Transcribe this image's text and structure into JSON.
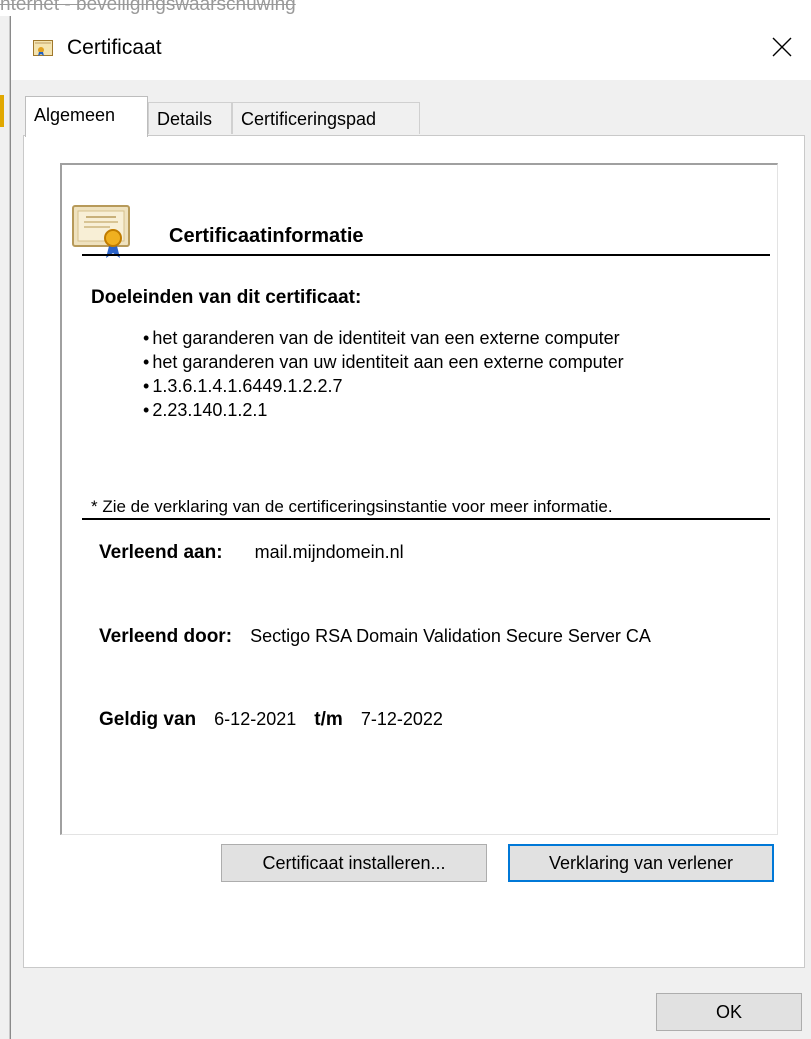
{
  "background_window": {
    "title": "nternet - beveiligingswaarschuwing"
  },
  "dialog": {
    "title": "Certificaat",
    "tabs": [
      {
        "label": "Algemeen",
        "active": true
      },
      {
        "label": "Details",
        "active": false
      },
      {
        "label": "Certificeringspad",
        "active": false
      }
    ]
  },
  "info": {
    "heading": "Certificaatinformatie",
    "purposes_title": "Doeleinden van dit certificaat:",
    "purposes": [
      "het garanderen van de identiteit van een externe computer",
      "het garanderen van uw identiteit aan een externe computer",
      "1.3.6.1.4.1.6449.1.2.2.7",
      "2.23.140.1.2.1"
    ],
    "note": "* Zie de verklaring van de certificeringsinstantie voor meer informatie.",
    "issued_to_label": "Verleend aan:",
    "issued_to": "mail.mijndomein.nl",
    "issued_by_label": "Verleend door:",
    "issued_by": "Sectigo RSA Domain Validation Secure Server CA",
    "valid_from_label": "Geldig van",
    "valid_from": "6-12-2021",
    "valid_to_label": "t/m",
    "valid_to": "7-12-2022"
  },
  "buttons": {
    "install": "Certificaat installeren...",
    "issuer_statement": "Verklaring van verlener",
    "ok": "OK"
  },
  "colors": {
    "accent": "#0078d7",
    "border": "#adadad",
    "panel": "#ffffff",
    "chrome": "#f0f0f0"
  },
  "icons": {
    "title": "certificate-icon",
    "close": "close-icon",
    "info": "certificate-document-icon"
  }
}
